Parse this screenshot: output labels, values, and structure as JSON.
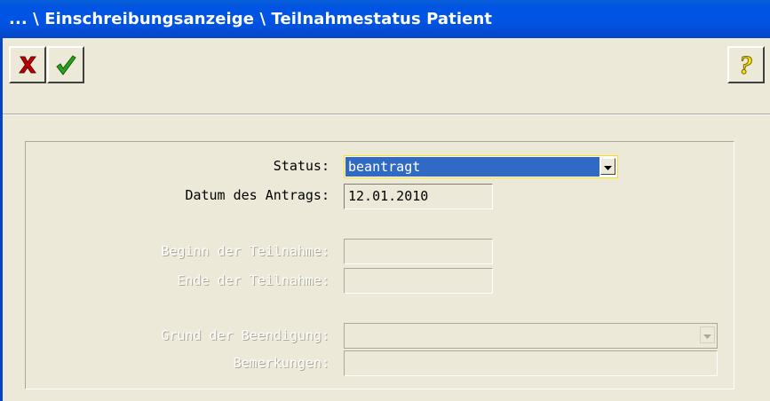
{
  "window": {
    "title": "... \\ Einschreibungsanzeige \\ Teilnahmestatus Patient"
  },
  "form": {
    "status_label": "Status:",
    "status_value": "beantragt",
    "datum_label": "Datum des Antrags:",
    "datum_value": "12.01.2010",
    "beginn_label": "Beginn der Teilnahme:",
    "beginn_value": "",
    "ende_label": "Ende der Teilnahme:",
    "ende_value": "",
    "grund_label": "Grund der Beendigung:",
    "grund_value": "",
    "bemerkungen_label": "Bemerkungen:",
    "bemerkungen_value": ""
  },
  "icons": {
    "cancel": "x-icon",
    "confirm": "check-icon",
    "help": "question-mark-icon"
  },
  "colors": {
    "titlebar": "#0054E3",
    "selection": "#316AC5",
    "cancel_red": "#CC0000",
    "confirm_green": "#2E9E1E",
    "help_yellow": "#F7E400"
  }
}
